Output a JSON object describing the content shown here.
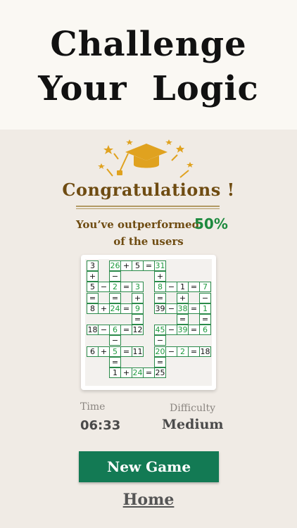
{
  "header": {
    "line1": "Challenge",
    "line2": "Your  Logic"
  },
  "result": {
    "title": "Congratulations !",
    "outperform_text": "You’ve outperformed",
    "outperform_pct": "50%",
    "outperform_suffix": "of the users"
  },
  "board": {
    "cells": [
      [
        "3",
        "",
        ""
      ],
      [
        "26",
        "g",
        ""
      ],
      [
        "+",
        "",
        ""
      ],
      [
        "5",
        "",
        ""
      ],
      [
        "=",
        "",
        ""
      ],
      [
        "31",
        "g",
        ""
      ],
      [
        "+",
        "",
        ""
      ],
      [
        "−",
        "",
        ""
      ],
      [
        "+",
        "",
        ""
      ],
      [
        "5",
        "",
        ""
      ],
      [
        "−",
        "",
        ""
      ],
      [
        "2",
        "g",
        ""
      ],
      [
        "=",
        "",
        ""
      ],
      [
        "3",
        "g",
        ""
      ],
      [
        "8",
        "g",
        ""
      ],
      [
        "−",
        "",
        ""
      ],
      [
        "1",
        "",
        ""
      ],
      [
        "=",
        "",
        ""
      ],
      [
        "7",
        "g",
        ""
      ],
      [
        "=",
        "",
        ""
      ],
      [
        "=",
        "",
        ""
      ],
      [
        "+",
        "",
        ""
      ],
      [
        "=",
        "",
        ""
      ],
      [
        "+",
        "",
        ""
      ],
      [
        "−",
        "",
        ""
      ],
      [
        "8",
        "",
        ""
      ],
      [
        "+",
        "",
        ""
      ],
      [
        "24",
        "g",
        ""
      ],
      [
        "=",
        "",
        ""
      ],
      [
        "9",
        "g",
        ""
      ],
      [
        "39",
        "",
        ""
      ],
      [
        "−",
        "",
        ""
      ],
      [
        "38",
        "g",
        ""
      ],
      [
        "=",
        "",
        ""
      ],
      [
        "1",
        "g",
        ""
      ],
      [
        "=",
        "",
        ""
      ],
      [
        "=",
        "",
        ""
      ],
      [
        "=",
        "",
        ""
      ],
      [
        "18",
        "",
        ""
      ],
      [
        "−",
        "",
        ""
      ],
      [
        "6",
        "g",
        ""
      ],
      [
        "=",
        "",
        ""
      ],
      [
        "12",
        "",
        ""
      ],
      [
        "45",
        "g",
        ""
      ],
      [
        "−",
        "",
        ""
      ],
      [
        "39",
        "g",
        ""
      ],
      [
        "=",
        "",
        ""
      ],
      [
        "6",
        "g",
        ""
      ],
      [
        "−",
        "",
        ""
      ],
      [
        "−",
        "",
        ""
      ],
      [
        "6",
        "",
        ""
      ],
      [
        "+",
        "",
        ""
      ],
      [
        "5",
        "g",
        ""
      ],
      [
        "=",
        "",
        ""
      ],
      [
        "11",
        "",
        ""
      ],
      [
        "20",
        "g",
        ""
      ],
      [
        "−",
        "",
        ""
      ],
      [
        "2",
        "g",
        ""
      ],
      [
        "=",
        "",
        ""
      ],
      [
        "18",
        "",
        ""
      ],
      [
        "=",
        "",
        ""
      ],
      [
        "=",
        "",
        ""
      ],
      [
        "1",
        "",
        ""
      ],
      [
        "+",
        "",
        ""
      ],
      [
        "24",
        "g",
        ""
      ],
      [
        "=",
        "",
        ""
      ],
      [
        "25",
        "",
        ""
      ]
    ]
  },
  "stats": {
    "time_label": "Time",
    "time_value": "06:33",
    "difficulty_label": "Difficulty",
    "difficulty_value": "Medium"
  },
  "actions": {
    "new_game": "New Game",
    "home": "Home"
  },
  "colors": {
    "accent_green": "#137a54",
    "gold": "#e0a21f",
    "brown": "#6f4c12"
  },
  "icons": {
    "decoration": "graduation-cap-icon",
    "sparkles": "star-icon"
  }
}
